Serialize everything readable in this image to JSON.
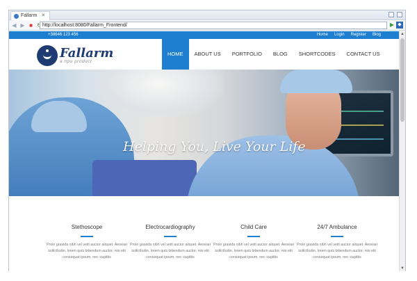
{
  "browser": {
    "tab_title": "Fallarm",
    "tab_close": "✕",
    "url": "http://localhost:8080/Fallarm_Frontend/"
  },
  "site": {
    "topbar": {
      "phone": "+38646 123 456",
      "links": [
        "Home",
        "Login",
        "Register",
        "Blog"
      ]
    },
    "logo": {
      "name": "Fallarm",
      "tagline": "a npu product"
    },
    "menu": [
      "HOME",
      "ABOUT US",
      "PORTFOLIO",
      "BLOG",
      "SHORTCODES",
      "CONTACT US"
    ],
    "menu_active": "HOME",
    "hero_tagline": "Helping You, Live Your Life",
    "services": [
      {
        "title": "Stethoscope",
        "text": "Proin gravida nibh vel velit auctor aliquet. Aenean sollicitudin, lorem quis bibendum auctor, nisi elit consequat ipsum, nec sagittis"
      },
      {
        "title": "Electrocardiography",
        "text": "Proin gravida nibh vel velit auctor aliquet. Aenean sollicitudin, lorem quis bibendum auctor, nisi elit consequat ipsum, nec sagittis"
      },
      {
        "title": "Child Care",
        "text": "Proin gravida nibh vel velit auctor aliquet. Aenean sollicitudin, lorem quis bibendum auctor, nisi elit consequat ipsum, nec sagittis"
      },
      {
        "title": "24/7 Ambulance",
        "text": "Proin gravida nibh vel velit auctor aliquet. Aenean sollicitudin, lorem quis bibendum auctor, nisi elit consequat ipsum, nec sagittis"
      }
    ],
    "colors": {
      "accent": "#1e7fd0",
      "logo_navy": "#1f3b73"
    }
  },
  "icons": {
    "back": "back-arrow-icon",
    "forward": "forward-arrow-icon",
    "stop": "stop-icon",
    "refresh": "refresh-icon",
    "go": "go-arrow-icon",
    "extension": "extension-icon"
  }
}
